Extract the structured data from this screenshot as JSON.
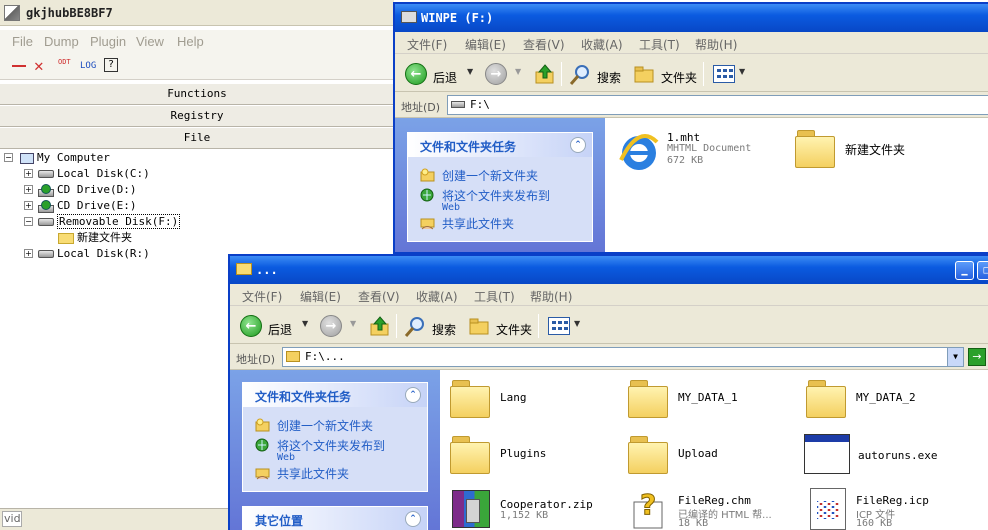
{
  "tool": {
    "title": "gkjhubBE8BF7",
    "menu": [
      "File",
      "Dump",
      "Plugin",
      "View",
      "Help"
    ],
    "toolbar": {
      "odt": "ODT",
      "log": "LOG",
      "help": "?"
    },
    "sections": [
      "Functions",
      "Registry",
      "File"
    ],
    "tree": {
      "root": "My Computer",
      "items": [
        "Local Disk(C:)",
        "CD Drive(D:)",
        "CD Drive(E:)",
        "Removable Disk(F:)",
        "新建文件夹",
        "Local Disk(R:)"
      ]
    },
    "status": "vid"
  },
  "win1": {
    "title": "WINPE (F:)",
    "menu": [
      "文件(F)",
      "编辑(E)",
      "查看(V)",
      "收藏(A)",
      "工具(T)",
      "帮助(H)"
    ],
    "toolbar": {
      "back": "后退",
      "search": "搜索",
      "folders": "文件夹"
    },
    "address_label": "地址(D)",
    "address": "F:\\",
    "tasks": {
      "title": "文件和文件夹任务",
      "items": [
        "创建一个新文件夹",
        "将这个文件夹发布到",
        "共享此文件夹"
      ],
      "web": "Web"
    },
    "files": [
      {
        "name": "1.mht",
        "type": "MHTML Document",
        "size": "672 KB"
      },
      {
        "name": "新建文件夹"
      }
    ]
  },
  "win2": {
    "title": "...",
    "menu": [
      "文件(F)",
      "编辑(E)",
      "查看(V)",
      "收藏(A)",
      "工具(T)",
      "帮助(H)"
    ],
    "toolbar": {
      "back": "后退",
      "search": "搜索",
      "folders": "文件夹"
    },
    "address_label": "地址(D)",
    "address": "F:\\...",
    "tasks": {
      "title": "文件和文件夹任务",
      "items": [
        "创建一个新文件夹",
        "将这个文件夹发布到",
        "共享此文件夹"
      ],
      "web": "Web"
    },
    "other": "其它位置",
    "files": [
      {
        "name": "Lang"
      },
      {
        "name": "MY_DATA_1"
      },
      {
        "name": "MY_DATA_2"
      },
      {
        "name": "Plugins"
      },
      {
        "name": "Upload"
      },
      {
        "name": "autoruns.exe"
      },
      {
        "name": "Cooperator.zip",
        "size": "1,152 KB"
      },
      {
        "name": "FileReg.chm",
        "type": "已编译的 HTML 帮...",
        "size": "18 KB"
      },
      {
        "name": "FileReg.icp",
        "type": "ICP 文件",
        "size": "160 KB"
      }
    ]
  }
}
